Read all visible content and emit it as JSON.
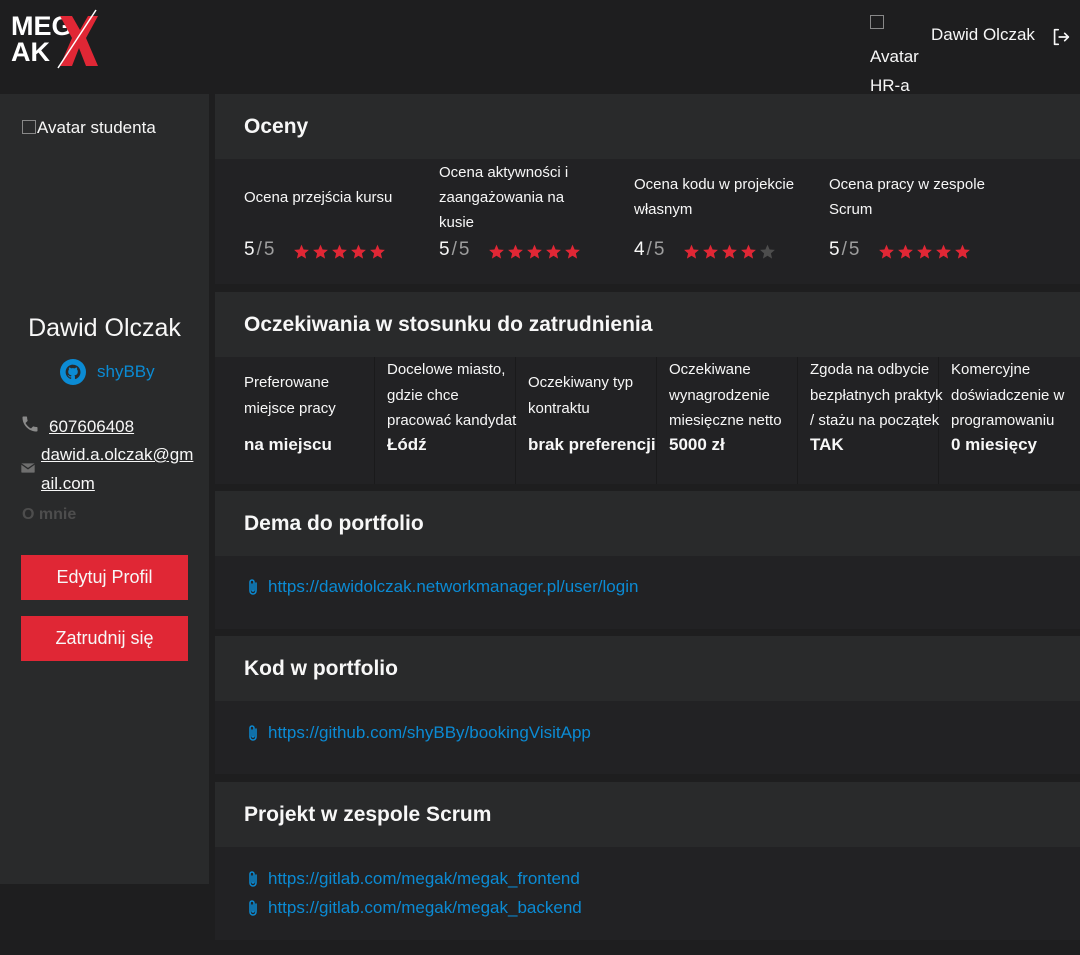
{
  "header": {
    "logo_text_line1": "MEG",
    "logo_text_line2": "AK",
    "hr_avatar_alt": "Avatar HR-a",
    "hr_name": "Dawid Olczak",
    "logout_icon": "logout-icon"
  },
  "student": {
    "avatar_alt": "Avatar studenta",
    "name": "Dawid Olczak",
    "github": "shyBBy",
    "phone": "607606408",
    "email_line1": "dawid.a.olczak@gm",
    "email_line2": "ail.com",
    "about": "O mnie",
    "edit_button": "Edytuj Profil",
    "hire_button": "Zatrudnij się"
  },
  "grades": {
    "title": "Oceny",
    "items": [
      {
        "label_lines": [
          "Ocena przejścia kursu"
        ],
        "score": "5",
        "sep": "/",
        "max": "5",
        "stars_filled": 5
      },
      {
        "label_lines": [
          "Ocena aktywności i",
          "zaangażowania na",
          "kusie"
        ],
        "score": "5",
        "sep": "/",
        "max": "5",
        "stars_filled": 5
      },
      {
        "label_lines": [
          "Ocena kodu w projekcie",
          "własnym"
        ],
        "score": "4",
        "sep": "/",
        "max": "5",
        "stars_filled": 4
      },
      {
        "label_lines": [
          "Ocena pracy w zespole",
          "Scrum"
        ],
        "score": "5",
        "sep": "/",
        "max": "5",
        "stars_filled": 5
      }
    ]
  },
  "expectations": {
    "title": "Oczekiwania w stosunku do zatrudnienia",
    "items": [
      {
        "label_lines": [
          "Preferowane",
          "miejsce pracy"
        ],
        "value": "na miejscu"
      },
      {
        "label_lines": [
          "Docelowe miasto,",
          "gdzie chce",
          "pracować kandydat"
        ],
        "value": "Łódź"
      },
      {
        "label_lines": [
          "Oczekiwany typ",
          "kontraktu"
        ],
        "value": "brak preferencji"
      },
      {
        "label_lines": [
          "Oczekiwane",
          "wynagrodzenie",
          "miesięczne netto"
        ],
        "value": "5000 zł"
      },
      {
        "label_lines": [
          "Zgoda na odbycie",
          "bezpłatnych praktyk",
          "/ stażu na początek"
        ],
        "value": "TAK"
      },
      {
        "label_lines": [
          "Komercyjne",
          "doświadczenie w",
          "programowaniu"
        ],
        "value": "0 miesięcy"
      }
    ]
  },
  "portfolio": {
    "title": "Dema do portfolio",
    "links": [
      "https://dawidolczak.networkmanager.pl/user/login"
    ]
  },
  "code": {
    "title": "Kod w portfolio",
    "links": [
      "https://github.com/shyBBy/bookingVisitApp"
    ]
  },
  "scrum": {
    "title": "Projekt w zespole Scrum",
    "links": [
      "https://gitlab.com/megak/megak_frontend",
      "https://gitlab.com/megak/megak_backend"
    ]
  },
  "colors": {
    "accent": "#e02735",
    "link": "#0b8bd4",
    "star_empty": "#4d4d4d"
  }
}
